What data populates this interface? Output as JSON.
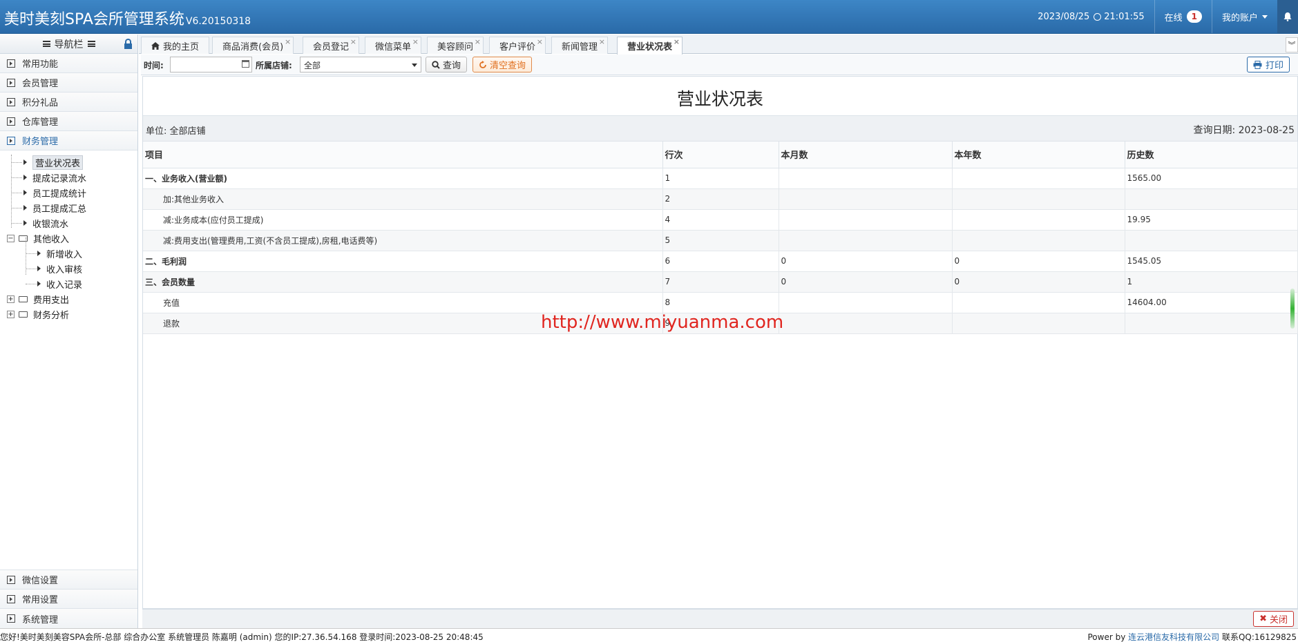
{
  "header": {
    "title": "美时美刻SPA会所管理系统",
    "version": "V6.20150318",
    "date": "2023/08/25",
    "time": "21:01:55",
    "online_label": "在线",
    "online_count": "1",
    "account_label": "我的账户"
  },
  "sidebar": {
    "nav_title": "导航栏",
    "sections_top": [
      "常用功能",
      "会员管理",
      "积分礼品",
      "仓库管理",
      "财务管理"
    ],
    "tree": {
      "leaf1": "营业状况表",
      "leaf2": "提成记录流水",
      "leaf3": "员工提成统计",
      "leaf4": "员工提成汇总",
      "leaf5": "收银流水",
      "folder_other": "其他收入",
      "other_children": [
        "新增收入",
        "收入审核",
        "收入记录"
      ],
      "folder_expense": "费用支出",
      "folder_analysis": "财务分析"
    },
    "sections_bottom": [
      "微信设置",
      "常用设置",
      "系统管理"
    ]
  },
  "tabs": [
    "我的主页",
    "商品消费(会员)",
    "会员登记",
    "微信菜单",
    "美容顾问",
    "客户评价",
    "新闻管理",
    "营业状况表"
  ],
  "toolbar": {
    "time_label": "时间:",
    "store_label": "所属店铺:",
    "store_value": "全部",
    "query_btn": "查询",
    "clear_btn": "清空查询",
    "print_btn": "打印"
  },
  "report": {
    "title": "营业状况表",
    "unit": "单位:  全部店铺",
    "query_date": "查询日期:  2023-08-25",
    "columns": [
      "项目",
      "行次",
      "本月数",
      "本年数",
      "历史数"
    ],
    "rows": [
      [
        "一、业务收入(营业额)",
        "1",
        "",
        "",
        "1565.00"
      ],
      [
        "加:其他业务收入",
        "2",
        "",
        "",
        ""
      ],
      [
        "减:业务成本(应付员工提成)",
        "4",
        "",
        "",
        "19.95"
      ],
      [
        "减:费用支出(管理费用,工资(不含员工提成),房租,电话费等)",
        "5",
        "",
        "",
        ""
      ],
      [
        "二、毛利润",
        "6",
        "0",
        "0",
        "1545.05"
      ],
      [
        "三、会员数量",
        "7",
        "0",
        "0",
        "1"
      ],
      [
        "充值",
        "8",
        "",
        "",
        "14604.00"
      ],
      [
        "退款",
        "9",
        "",
        "",
        ""
      ]
    ],
    "watermark": "http://www.miyuanma.com",
    "close_btn": "关闭"
  },
  "status": {
    "left": "您好!美时美刻美容SPA会所-总部 综合办公室 系统管理员 陈嘉明 (admin) 您的IP:27.36.54.168 登录时间:2023-08-25 20:48:45",
    "power_by": "Power by",
    "company": "连云港信友科技有限公司",
    "contact": "联系QQ:16129825"
  },
  "colors": {
    "header": "#2f76b8",
    "accent": "#2a6aa8",
    "watermark": "#e0251f",
    "close": "#c9302c",
    "clear": "#e07020"
  }
}
